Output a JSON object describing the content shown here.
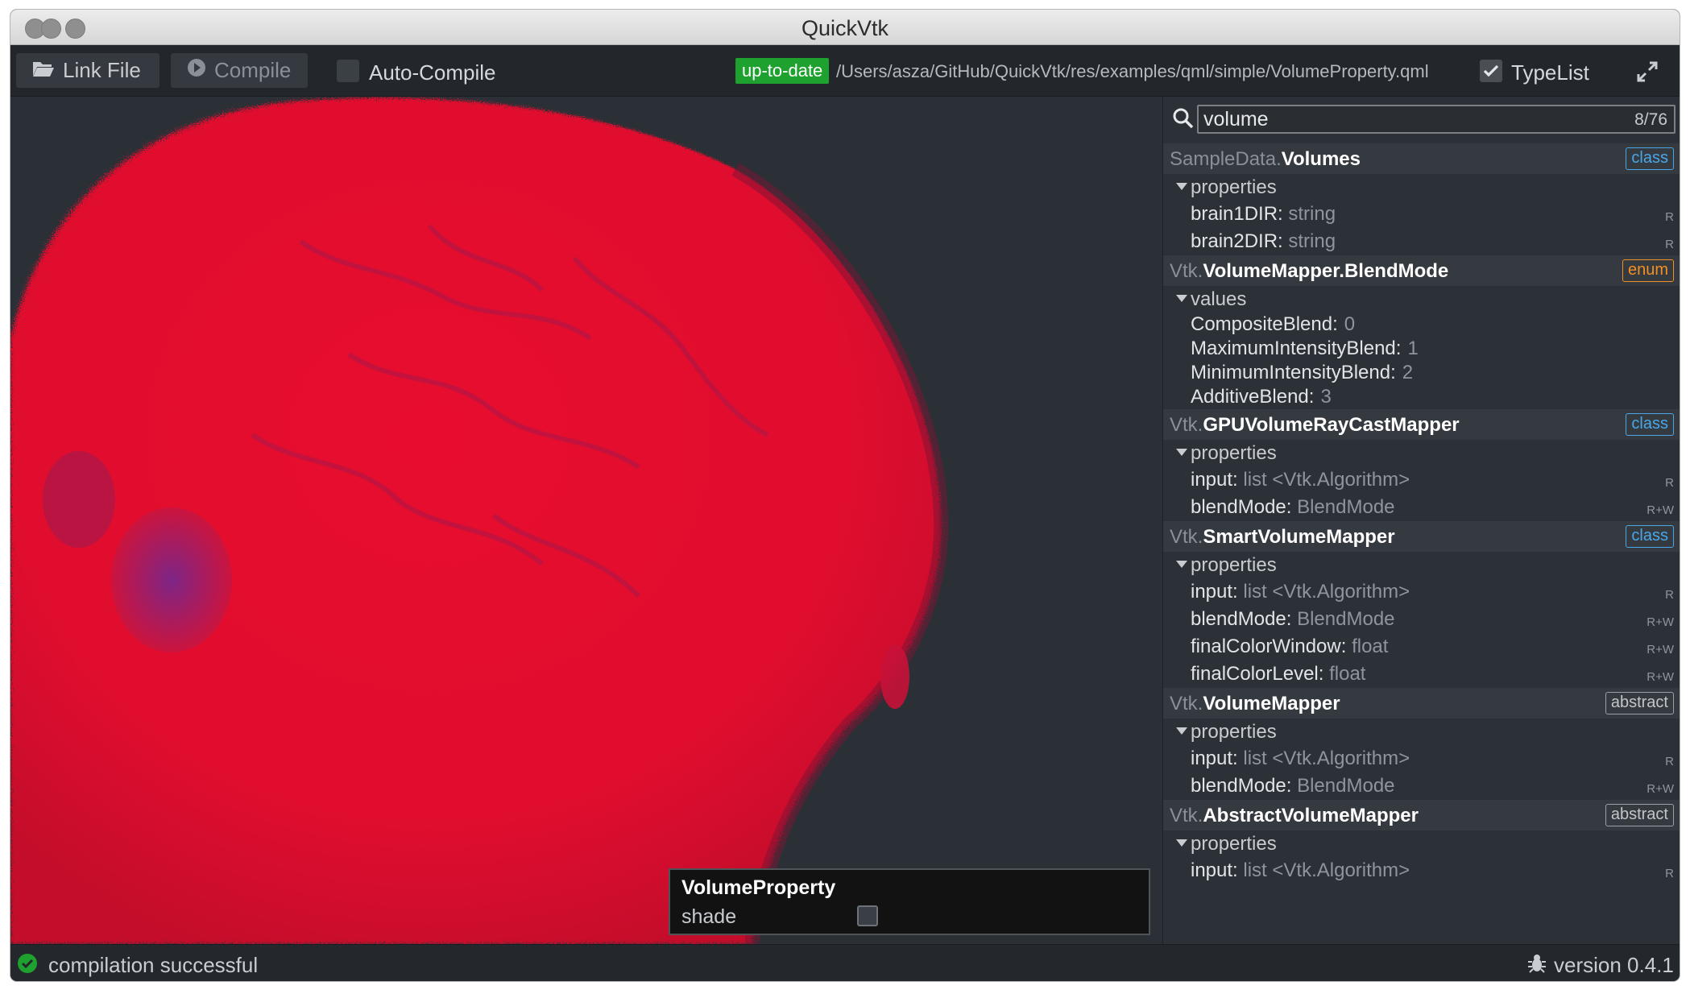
{
  "window": {
    "title": "QuickVtk"
  },
  "toolbar": {
    "link_file": "Link File",
    "compile": "Compile",
    "auto_compile": "Auto-Compile",
    "status_badge": "up-to-date",
    "file_path": "/Users/asza/GitHub/QuickVtk/res/examples/qml/simple/VolumeProperty.qml",
    "typelist": "TypeList",
    "typelist_checked": true
  },
  "overlay": {
    "title": "VolumeProperty",
    "shade_label": "shade",
    "shade_checked": false
  },
  "search": {
    "query": "volume",
    "count": "8/76"
  },
  "types": [
    {
      "ns": "SampleData.",
      "name": "Volumes",
      "tag": "class",
      "section": "properties",
      "items": [
        {
          "name": "brain1DIR: ",
          "type": "string",
          "access": "R"
        },
        {
          "name": "brain2DIR: ",
          "type": "string",
          "access": "R"
        }
      ]
    },
    {
      "ns": "Vtk.",
      "name": "VolumeMapper.BlendMode",
      "tag": "enum",
      "section": "values",
      "values": [
        {
          "name": "CompositeBlend:",
          "value": "0"
        },
        {
          "name": "MaximumIntensityBlend:",
          "value": "1"
        },
        {
          "name": "MinimumIntensityBlend:",
          "value": "2"
        },
        {
          "name": "AdditiveBlend:",
          "value": "3"
        }
      ]
    },
    {
      "ns": "Vtk.",
      "name": "GPUVolumeRayCastMapper",
      "tag": "class",
      "section": "properties",
      "items": [
        {
          "name": "input: ",
          "type": "list <Vtk.Algorithm>",
          "access": "R"
        },
        {
          "name": "blendMode: ",
          "type": "BlendMode",
          "access": "R+W"
        }
      ]
    },
    {
      "ns": "Vtk.",
      "name": "SmartVolumeMapper",
      "tag": "class",
      "section": "properties",
      "items": [
        {
          "name": "input: ",
          "type": "list <Vtk.Algorithm>",
          "access": "R"
        },
        {
          "name": "blendMode: ",
          "type": "BlendMode",
          "access": "R+W"
        },
        {
          "name": "finalColorWindow: ",
          "type": "float",
          "access": "R+W"
        },
        {
          "name": "finalColorLevel: ",
          "type": "float",
          "access": "R+W"
        }
      ]
    },
    {
      "ns": "Vtk.",
      "name": "VolumeMapper",
      "tag": "abstract",
      "section": "properties",
      "items": [
        {
          "name": "input: ",
          "type": "list <Vtk.Algorithm>",
          "access": "R"
        },
        {
          "name": "blendMode: ",
          "type": "BlendMode",
          "access": "R+W"
        }
      ]
    },
    {
      "ns": "Vtk.",
      "name": "AbstractVolumeMapper",
      "tag": "abstract",
      "section": "properties",
      "items": [
        {
          "name": "input: ",
          "type": "list <Vtk.Algorithm>",
          "access": "R"
        }
      ]
    }
  ],
  "statusbar": {
    "message": "compilation successful",
    "version": "version 0.4.1"
  },
  "colors": {
    "accent_green": "#1fa12f",
    "tag_class": "#49a7e8",
    "tag_enum": "#f19024",
    "volume_red": "#e0102e"
  },
  "icons": {
    "link_file": "folder-open-icon",
    "compile": "play-circle-icon",
    "search": "search-icon",
    "status": "check-circle-icon",
    "version": "bug-icon",
    "expand": "expand-icon"
  }
}
